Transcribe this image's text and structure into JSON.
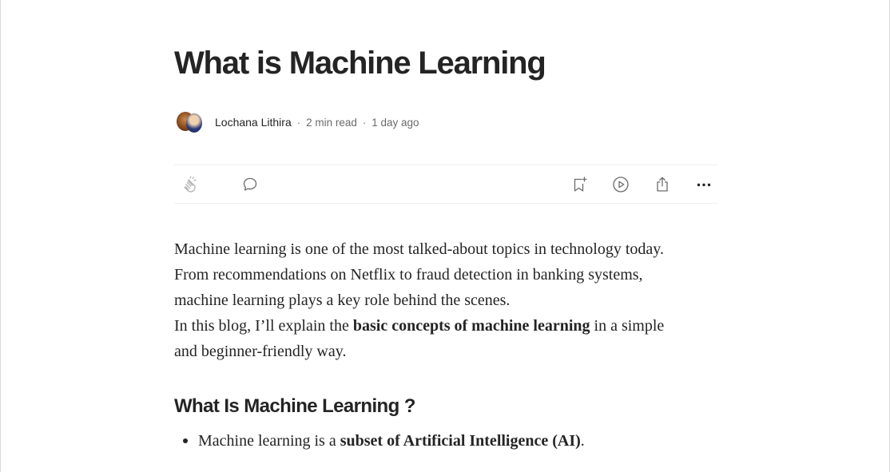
{
  "article": {
    "title": "What is Machine Learning",
    "author": "Lochana Lithira",
    "read_time": "2 min read",
    "published": "1 day ago",
    "separator": "·"
  },
  "body": {
    "paragraph_1_lines": [
      "Machine learning is one of the most talked-about topics in technology today.",
      "From recommendations on Netflix to fraud detection in banking systems,",
      "machine learning plays a key role behind the scenes."
    ],
    "paragraph_2_prefix": "In this blog, I’ll explain the ",
    "paragraph_2_bold": "basic concepts of machine learning",
    "paragraph_2_suffix": " in a simple",
    "paragraph_2_line_2": "and beginner-friendly way."
  },
  "section": {
    "heading": "What Is Machine Learning ?",
    "bullet_1_prefix": "Machine learning is a ",
    "bullet_1_bold": "subset of Artificial Intelligence (AI)",
    "bullet_1_suffix": "."
  },
  "icons": {
    "clap": "clap-icon",
    "comment": "comment-icon",
    "bookmark": "bookmark-add-icon",
    "listen": "play-icon",
    "share": "share-icon",
    "more": "more-icon"
  },
  "colors": {
    "text": "#242424",
    "meta": "#6b6b6b",
    "icon": "#6b6b6b",
    "divider": "#eeeeee"
  }
}
